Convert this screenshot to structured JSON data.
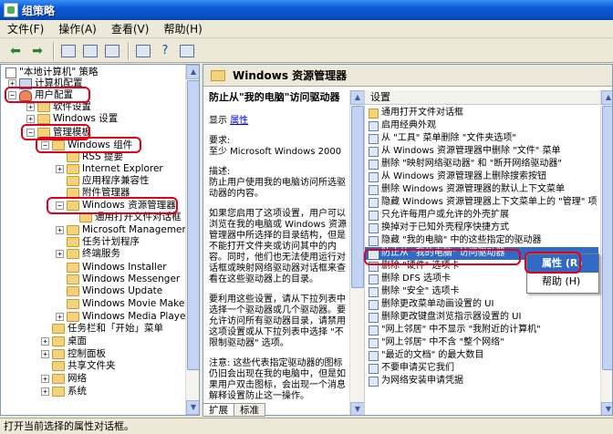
{
  "window": {
    "title": "组策略"
  },
  "menu": [
    "文件(F)",
    "操作(A)",
    "查看(V)",
    "帮助(H)"
  ],
  "tree": {
    "root": "\"本地计算机\" 策略",
    "items": [
      {
        "label": "计算机配置",
        "exp": "+"
      },
      {
        "label": "用户配置",
        "exp": "−"
      },
      {
        "label": "软件设置",
        "exp": "+"
      },
      {
        "label": "Windows 设置",
        "exp": "+"
      },
      {
        "label": "管理模板",
        "exp": "−"
      },
      {
        "label": "Windows 组件",
        "exp": "−"
      },
      {
        "label": "RSS 提要",
        "exp": ""
      },
      {
        "label": "Internet Explorer",
        "exp": "+"
      },
      {
        "label": "应用程序兼容性",
        "exp": ""
      },
      {
        "label": "附件管理器",
        "exp": ""
      },
      {
        "label": "Windows 资源管理器",
        "exp": "−"
      },
      {
        "label": "通用打开文件对话框",
        "exp": ""
      },
      {
        "label": "Microsoft Management Conso",
        "exp": "+"
      },
      {
        "label": "任务计划程序",
        "exp": ""
      },
      {
        "label": "终端服务",
        "exp": "+"
      },
      {
        "label": "Windows Installer",
        "exp": ""
      },
      {
        "label": "Windows Messenger",
        "exp": ""
      },
      {
        "label": "Windows Update",
        "exp": ""
      },
      {
        "label": "Windows Movie Maker",
        "exp": ""
      },
      {
        "label": "Windows Media Player",
        "exp": "+"
      },
      {
        "label": "任务栏和「开始」菜单",
        "exp": ""
      },
      {
        "label": "桌面",
        "exp": "+"
      },
      {
        "label": "控制面板",
        "exp": "+"
      },
      {
        "label": "共享文件夹",
        "exp": ""
      },
      {
        "label": "网络",
        "exp": "+"
      },
      {
        "label": "系统",
        "exp": "+"
      }
    ]
  },
  "right": {
    "header": "Windows 资源管理器",
    "desc": {
      "title": "防止从\"我的电脑\"访问驱动器",
      "show_label": "显示",
      "show_link": "属性",
      "req_label": "要求:",
      "req_value": "至少 Microsoft Windows 2000",
      "desc_label": "描述:",
      "desc_text": "防止用户使用我的电脑访问所选驱动器的内容。",
      "p1": "如果您启用了这项设置，用户可以浏览在我的电脑或 Windows 资源管理器中所选择的目录结构，但是不能打开文件夹或访问其中的内容。同时，他们也无法使用运行对话框或映射网络驱动器对话框来查看在这些驱动器上的目录。",
      "p2": "要利用这些设置，请从下拉列表中选择一个驱动器或几个驱动器。要允许访问所有驱动器目录，请禁用这项设置或从下拉列表中选择 \"不限制驱动器\" 选项。",
      "p3": "注意: 这些代表指定驱动器的图标仍旧会出现在我的电脑中，但是如果用户双击图标，会出现一个消息解释设置防止这一操作。"
    },
    "settings_header": "设置",
    "settings": [
      {
        "label": "通用打开文件对话框",
        "folder": true
      },
      {
        "label": "启用经典外观"
      },
      {
        "label": "从 \"工具\" 菜单删除 \"文件夹选项\""
      },
      {
        "label": "从 Windows 资源管理器中删除 \"文件\" 菜单"
      },
      {
        "label": "删除 \"映射网络驱动器\" 和 \"断开网络驱动器\""
      },
      {
        "label": "从 Windows 资源管理器上删除搜索按钮"
      },
      {
        "label": "删除 Windows 资源管理器的默认上下文菜单"
      },
      {
        "label": "隐藏 Windows 资源管理器上下文菜单上的 \"管理\" 项"
      },
      {
        "label": "只允许每用户或允许的外壳扩展"
      },
      {
        "label": "换掉对于已知外壳程序快捷方式"
      },
      {
        "label": "隐藏 \"我的电脑\" 中的这些指定的驱动器"
      },
      {
        "label": "防止从 \"我的电脑\" 访问驱动器",
        "selected": true
      },
      {
        "label": "删除 \"硬件\" 选项卡"
      },
      {
        "label": "删除 DFS 选项卡"
      },
      {
        "label": "删除 \"安全\" 选项卡"
      },
      {
        "label": "删除更改菜单动画设置的 UI"
      },
      {
        "label": "删除更改键盘浏览指示器设置的 UI"
      },
      {
        "label": "\"网上邻居\" 中不显示 \"我附近的计算机\""
      },
      {
        "label": "\"网上邻居\" 中不含 \"整个网络\""
      },
      {
        "label": "\"最近的文档\" 的最大数目"
      },
      {
        "label": "不要申请买它我们"
      },
      {
        "label": "为网络安装申请凭据"
      }
    ]
  },
  "context_menu": [
    {
      "label": "属性 (R)",
      "highlight": true
    },
    {
      "label": "帮助 (H)"
    }
  ],
  "tabs": [
    "扩展",
    "标准"
  ],
  "status": "打开当前选择的属性对话框。",
  "colors": {
    "selection": "#316ac5",
    "annotation": "#e0001b",
    "title_bar": "#0a5bd6"
  }
}
